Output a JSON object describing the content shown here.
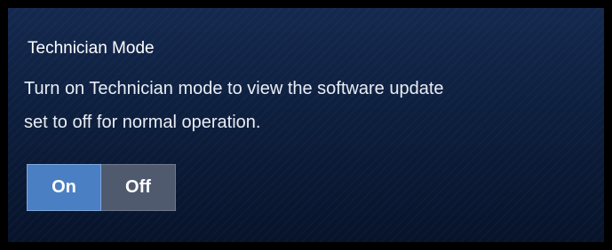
{
  "settings": {
    "title": "Technician Mode",
    "description_line1": "Turn on Technician mode to view the software update",
    "description_line2": "set to off for normal operation.",
    "toggle": {
      "on_label": "On",
      "off_label": "Off",
      "selected": "On"
    }
  },
  "colors": {
    "panel_background": "#0d1f3e",
    "selected_button": "#4a7fc4",
    "unselected_button": "#4f5a6e",
    "text": "#ffffff"
  }
}
